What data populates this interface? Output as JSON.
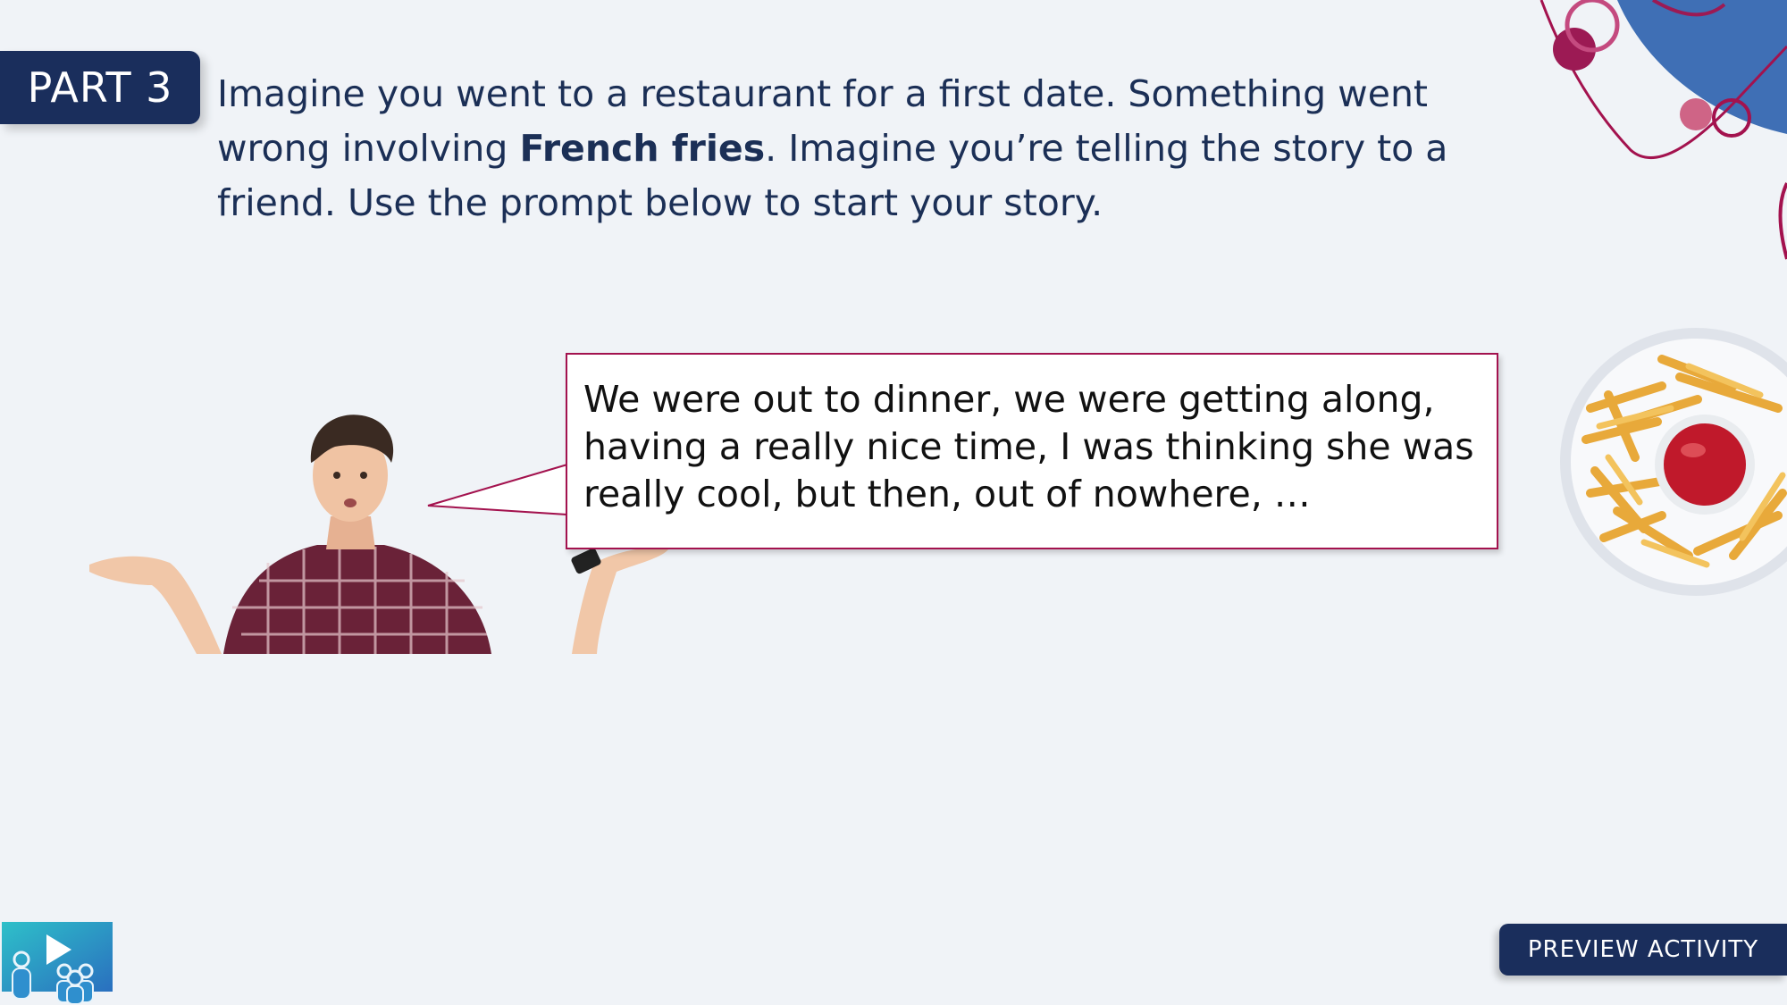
{
  "badge": {
    "label": "PART 3"
  },
  "instructions": {
    "part1": "Imagine you went to a restaurant for a first date. Something went wrong involving ",
    "bold": "French fries",
    "part2": ". Imagine you’re telling the story to a friend. Use the prompt below to start your story."
  },
  "speech": {
    "line1": "We were out to dinner, we were getting along,",
    "line2": "having a really nice time, I was thinking she was",
    "line3": "really cool, but then, out of nowhere, …"
  },
  "preview_button": {
    "label": "PREVIEW ACTIVITY"
  },
  "colors": {
    "navy": "#1a2e5c",
    "magenta": "#a3124e",
    "background": "#f0f3f7",
    "deco_blue": "#3f6fb5"
  },
  "icons": {
    "logo": "video-classroom-logo-icon",
    "fries": "french-fries-plate-icon",
    "person": "shrugging-man-illustration"
  }
}
